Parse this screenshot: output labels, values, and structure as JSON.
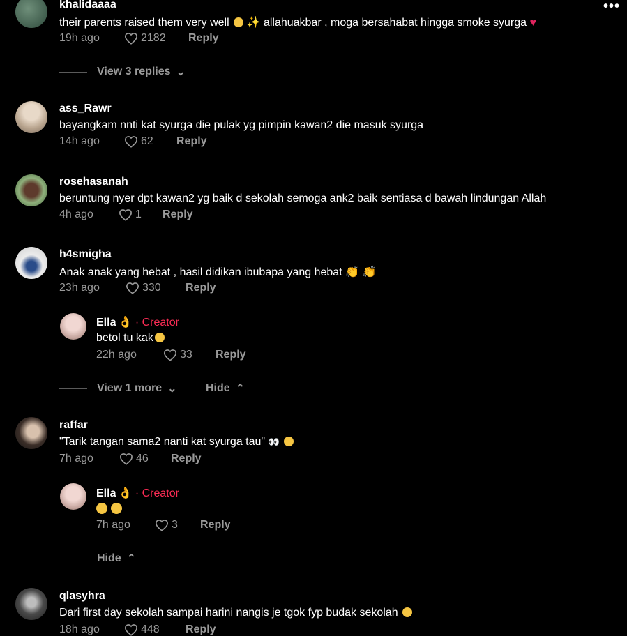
{
  "more_menu": "•••",
  "comments": [
    {
      "user": "khalidaaaa",
      "text": "their parents raised them very well",
      "text2": " allahuakbar , moga bersahabat hingga smoke syurga",
      "time": "19h ago",
      "likes": "2182",
      "reply": "Reply",
      "toggle": "View 3 replies"
    },
    {
      "user": "ass_Rawr",
      "text": "bayangkam nnti kat syurga die pulak yg pimpin kawan2 die masuk syurga",
      "time": "14h ago",
      "likes": "62",
      "reply": "Reply"
    },
    {
      "user": "rosehasanah",
      "text": "beruntung nyer dpt kawan2 yg baik d sekolah semoga ank2 baik sentiasa d bawah lindungan Allah",
      "time": "4h ago",
      "likes": "1",
      "reply": "Reply"
    },
    {
      "user": "h4smigha",
      "text": "Anak anak yang hebat , hasil didikan ibubapa yang hebat",
      "time": "23h ago",
      "likes": "330",
      "reply": "Reply",
      "reply_item": {
        "user": "Ella",
        "badge": "· Creator",
        "text": "betol tu kak",
        "time": "22h ago",
        "likes": "33",
        "reply": "Reply"
      },
      "toggle": "View 1 more",
      "hide": "Hide"
    },
    {
      "user": "raffar",
      "text": "\"Tarik tangan sama2 nanti kat syurga tau\"",
      "time": "7h ago",
      "likes": "46",
      "reply": "Reply",
      "reply_item": {
        "user": "Ella",
        "badge": "· Creator",
        "text": "",
        "time": "7h ago",
        "likes": "3",
        "reply": "Reply"
      },
      "hide": "Hide"
    },
    {
      "user": "qlasyhra",
      "text": "Dari first day sekolah sampai harini nangis je tgok fyp budak sekolah",
      "time": "18h ago",
      "likes": "448",
      "reply": "Reply"
    }
  ],
  "colors": {
    "background": "#000000",
    "muted": "#9a9a9a",
    "creator": "#fe2c55"
  }
}
